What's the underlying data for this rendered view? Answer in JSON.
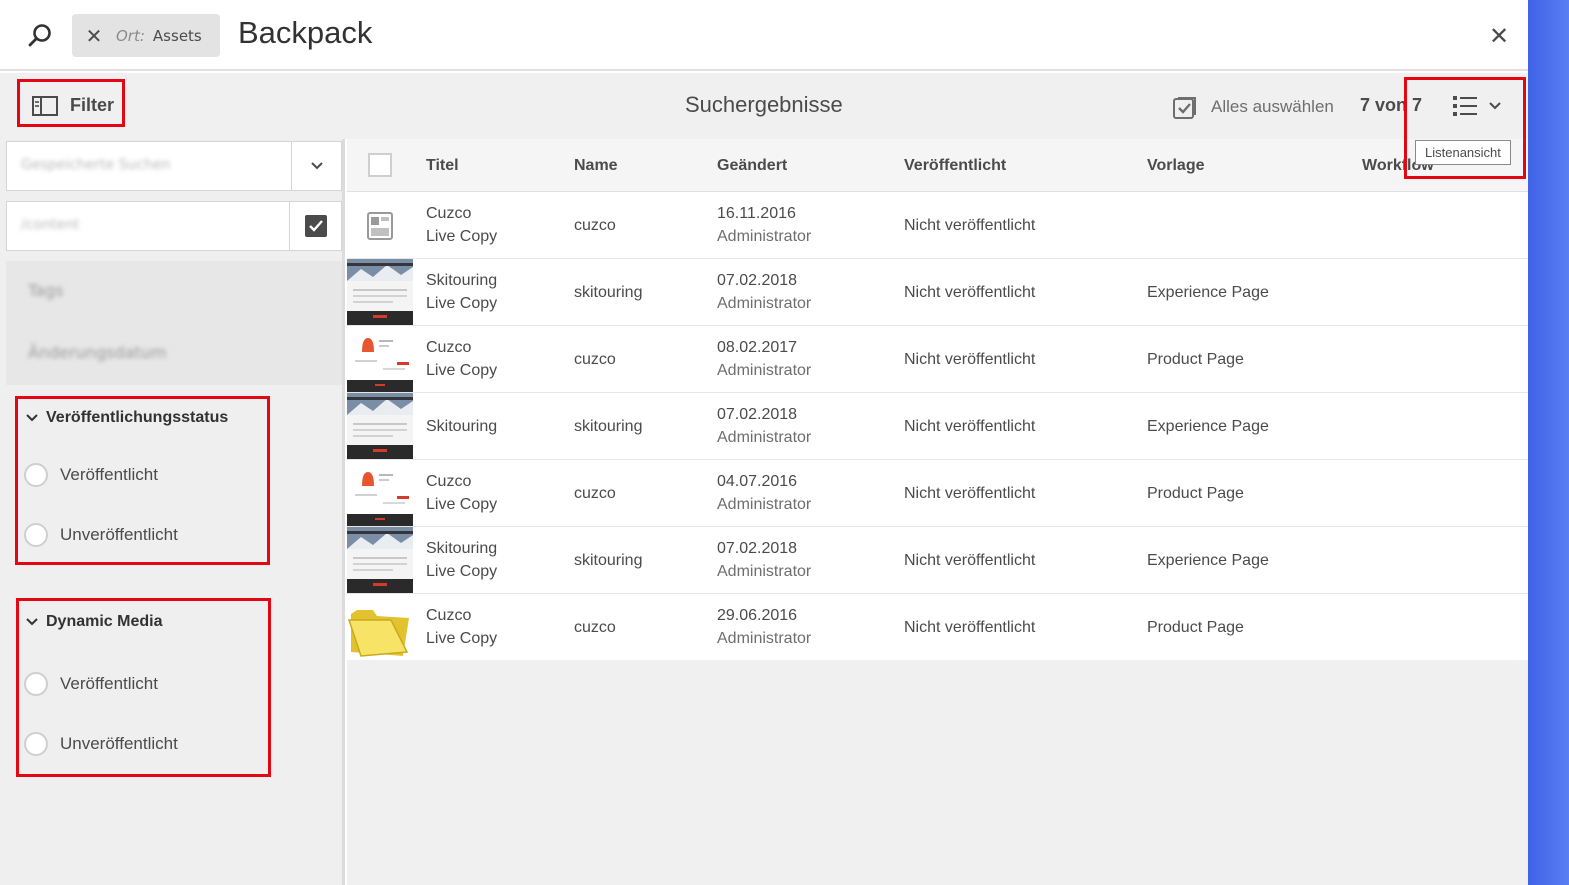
{
  "search": {
    "location_label": "Ort:",
    "location_value": "Assets",
    "term": "Backpack"
  },
  "toolbar": {
    "filter_label": "Filter",
    "results_title": "Suchergebnisse",
    "select_all_label": "Alles auswählen",
    "count": "7 von 7",
    "view_tooltip": "Listenansicht"
  },
  "sidebar": {
    "saved_searches_placeholder": "Gespeicherte Suchen",
    "path_value": "/content",
    "sections": [
      {
        "label": "Tags"
      },
      {
        "label": "Änderungsdatum"
      }
    ],
    "publication_status": {
      "title": "Veröffentlichungsstatus",
      "options": [
        "Veröffentlicht",
        "Unveröffentlicht"
      ]
    },
    "dynamic_media": {
      "title": "Dynamic Media",
      "options": [
        "Veröffentlicht",
        "Unveröffentlicht"
      ]
    }
  },
  "table": {
    "columns": [
      "Titel",
      "Name",
      "Geändert",
      "Veröffentlicht",
      "Vorlage",
      "Workflow"
    ],
    "rows": [
      {
        "thumb": "page-icon",
        "title1": "Cuzco",
        "title2": "Live Copy",
        "name": "cuzco",
        "date": "16.11.2016",
        "user": "Administrator",
        "published": "Nicht veröffentlicht",
        "template": ""
      },
      {
        "thumb": "skitouring",
        "title1": "Skitouring",
        "title2": "Live Copy",
        "name": "skitouring",
        "date": "07.02.2018",
        "user": "Administrator",
        "published": "Nicht veröffentlicht",
        "template": "Experience Page"
      },
      {
        "thumb": "cuzco",
        "title1": "Cuzco",
        "title2": "Live Copy",
        "name": "cuzco",
        "date": "08.02.2017",
        "user": "Administrator",
        "published": "Nicht veröffentlicht",
        "template": "Product Page"
      },
      {
        "thumb": "skitouring",
        "title1": "Skitouring",
        "title2": "",
        "name": "skitouring",
        "date": "07.02.2018",
        "user": "Administrator",
        "published": "Nicht veröffentlicht",
        "template": "Experience Page"
      },
      {
        "thumb": "cuzco",
        "title1": "Cuzco",
        "title2": "Live Copy",
        "name": "cuzco",
        "date": "04.07.2016",
        "user": "Administrator",
        "published": "Nicht veröffentlicht",
        "template": "Product Page"
      },
      {
        "thumb": "skitouring",
        "title1": "Skitouring",
        "title2": "Live Copy",
        "name": "skitouring",
        "date": "07.02.2018",
        "user": "Administrator",
        "published": "Nicht veröffentlicht",
        "template": "Experience Page"
      },
      {
        "thumb": "folder",
        "title1": "Cuzco",
        "title2": "Live Copy",
        "name": "cuzco",
        "date": "29.06.2016",
        "user": "Administrator",
        "published": "Nicht veröffentlicht",
        "template": "Product Page"
      }
    ]
  },
  "colors": {
    "highlight": "#e30613",
    "accent_strip": "#4a6cf0"
  }
}
